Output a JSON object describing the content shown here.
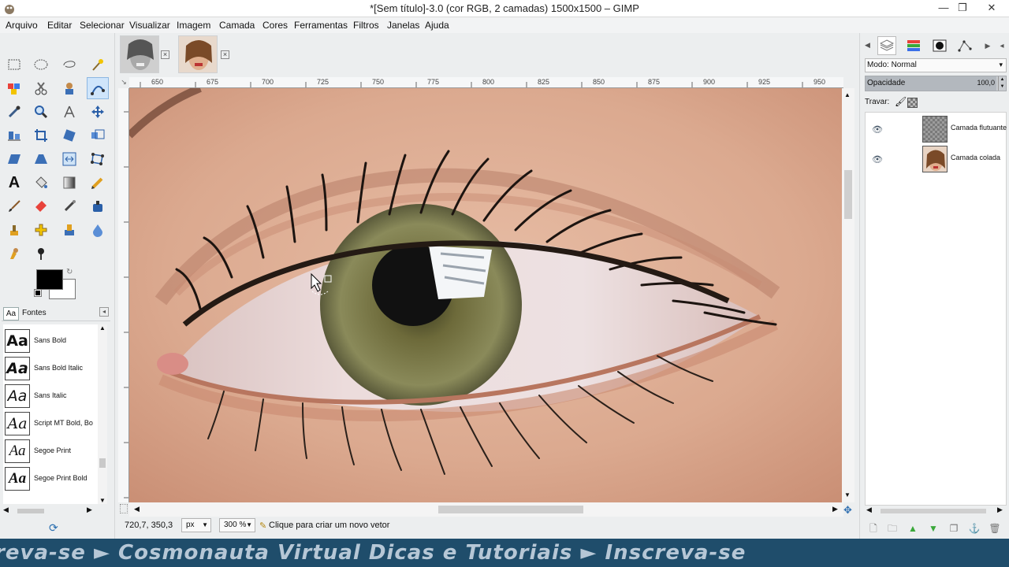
{
  "window": {
    "title": "*[Sem título]-3.0 (cor RGB, 2 camadas) 1500x1500 – GIMP",
    "minimize": "—",
    "maximize": "❐",
    "close": "✕"
  },
  "menu": [
    "Arquivo",
    "Editar",
    "Selecionar",
    "Visualizar",
    "Imagem",
    "Camada",
    "Cores",
    "Ferramentas",
    "Filtros",
    "Janelas",
    "Ajuda"
  ],
  "toolbox": {
    "fonts_tab": {
      "icon_text": "Aa",
      "label": "Fontes"
    },
    "fonts": [
      {
        "preview": "Aa",
        "name": "Sans Bold"
      },
      {
        "preview": "Aa",
        "name": "Sans Bold Italic"
      },
      {
        "preview": "Aa",
        "name": "Sans Italic"
      },
      {
        "preview": "Aa",
        "name": "Script MT Bold, Bo"
      },
      {
        "preview": "Aa",
        "name": "Segoe Print"
      },
      {
        "preview": "Aa",
        "name": "Segoe Print Bold"
      }
    ],
    "foreground_color": "#000000",
    "background_color": "#ffffff"
  },
  "ruler": {
    "top_ticks": [
      "650",
      "675",
      "700",
      "725",
      "750",
      "775",
      "800",
      "825",
      "850",
      "875",
      "900",
      "925",
      "950"
    ]
  },
  "status": {
    "coords": "720,7, 350,3",
    "unit": "px",
    "zoom": "300 %",
    "hint": "Clique para criar um novo vetor"
  },
  "layers_panel": {
    "mode_label": "Modo: Normal",
    "opacity_label": "Opacidade",
    "opacity_value": "100,0",
    "lock_label": "Travar:",
    "layers": [
      {
        "name": "Camada flutuante",
        "thumb": "checker"
      },
      {
        "name": "Camada colada",
        "thumb": "photo"
      }
    ]
  },
  "banner": {
    "text": "Inscreva-se ► Cosmonauta Virtual Dicas e Tutoriais ► Inscreva-se"
  }
}
